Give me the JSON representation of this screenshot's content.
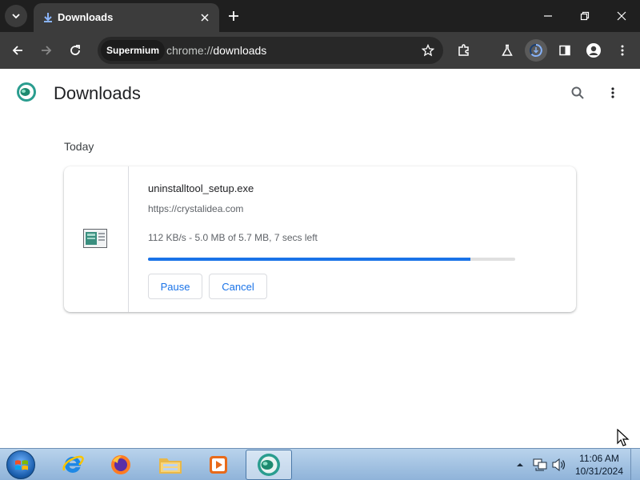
{
  "browser": {
    "tab": {
      "title": "Downloads"
    },
    "site_chip": "Supermium",
    "url": {
      "scheme": "chrome://",
      "host": "downloads"
    }
  },
  "page": {
    "title": "Downloads",
    "section": "Today",
    "download": {
      "file_name": "uninstalltool_setup.exe",
      "url": "https://crystalidea.com",
      "status": "112 KB/s - 5.0 MB of 5.7 MB, 7 secs left",
      "progress_fraction": 0.877,
      "pause_label": "Pause",
      "cancel_label": "Cancel"
    }
  },
  "taskbar": {
    "apps": [
      "internet-explorer-icon",
      "firefox-icon",
      "file-explorer-icon",
      "media-player-icon",
      "supermium-icon"
    ],
    "clock_time": "11:06 AM",
    "clock_date": "10/31/2024"
  },
  "colors": {
    "accent": "#1a73e8",
    "tabbar": "#1f1f1f",
    "toolbar": "#3c3c3c"
  }
}
